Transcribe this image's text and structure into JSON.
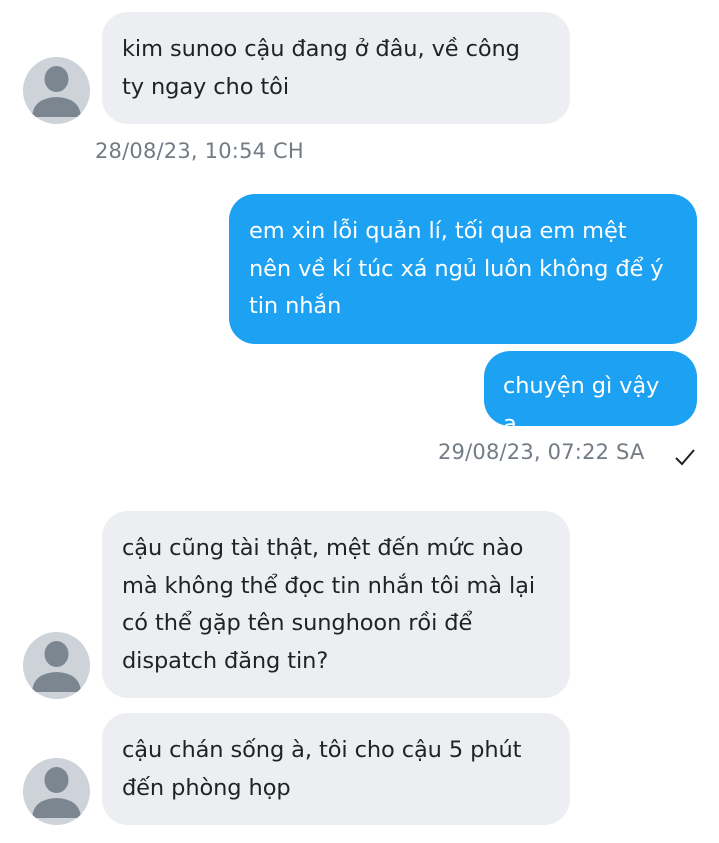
{
  "conversation": {
    "messages": [
      {
        "direction": "incoming",
        "text": "kim sunoo cậu đang ở đâu, về công\nty ngay cho tôi"
      },
      {
        "direction": "outgoing",
        "text": "em xin lỗi quản lí, tối qua em mệt\nnên về kí túc xá ngủ luôn không để ý\ntin nhắn"
      },
      {
        "direction": "outgoing",
        "text": "chuyện gì vậy ạ"
      },
      {
        "direction": "incoming",
        "text": "cậu cũng tài thật, mệt đến mức nào\nmà không thể đọc tin nhắn tôi mà lại\ncó thể gặp tên sunghoon rồi để\ndispatch đăng tin?"
      },
      {
        "direction": "incoming",
        "text": "cậu chán sống à, tôi cho cậu 5 phút\nđến phòng họp"
      }
    ],
    "timestamps": [
      {
        "text": "28/08/23, 10:54 CH"
      },
      {
        "text": "29/08/23, 07:22 SA",
        "status_icon": "checkmark-icon"
      }
    ]
  },
  "colors": {
    "incoming_bubble": "#eceef1",
    "outgoing_bubble": "#1da1f2",
    "avatar_bg": "#cdd3d9",
    "avatar_fg": "#7b8690",
    "timestamp": "#737b84"
  }
}
